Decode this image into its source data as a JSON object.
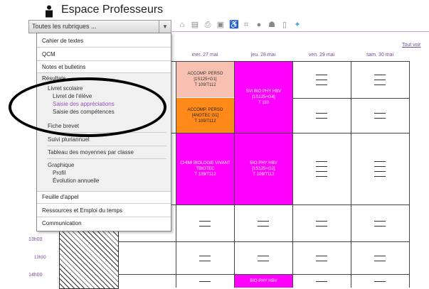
{
  "header": {
    "app_title": "Espace Professeurs"
  },
  "menu_combo": {
    "label": "Toutes les rubriques ..."
  },
  "toolbar": {
    "icons": [
      "home-icon",
      "calendar-icon",
      "print-icon",
      "document-icon",
      "accessibility-icon",
      "crop-icon",
      "help-icon",
      "people-icon",
      "notepad-icon",
      "twitter-icon"
    ]
  },
  "calendar": {
    "tout_voir": "Tout voir",
    "days": [
      "mer. 27 mai",
      "jeu. 28 mai",
      "ven. 29 mai",
      "sam. 30 mai"
    ],
    "times": [
      "13h00",
      "13h30",
      "14h00"
    ],
    "slots": {
      "s1": [
        "ACCOMP. PERSO",
        "[1S125+G1]",
        "T 109/T112"
      ],
      "s2": [
        "ACCOMP. PERSO",
        "[4NOTEC G1]",
        "T 109/T112"
      ],
      "s3": [
        "SVI BIO PHY HBV",
        "[1S125+G4]",
        "T 110"
      ],
      "s4": [
        "CHIMI BIOLOGIE VIVANT",
        "TBIOTEC",
        "T 109/T112"
      ],
      "s5": [
        "BIO PHY HBV",
        "[1S125+G2]",
        "T 109/T112"
      ],
      "s6": [
        "BIO PHY HBV"
      ]
    }
  },
  "menu": {
    "cahier": "Cahier de textes",
    "qcm": "QCM",
    "notes": "Notes et bulletins",
    "resultats": "Résultats",
    "livret_scolaire": "Livret scolaire",
    "livret_eleve": "Livret de l'élève",
    "saisie_appreciations": "Saisie des appréciations",
    "saisie_competences": "Saisie des compétences",
    "fiche_brevet": "Fiche brevet",
    "suivi_pluriannuel": "Suivi pluriannuel",
    "tableau_moyennes": "Tableau des moyennes par classe",
    "graphique": "Graphique",
    "profil": "Profil",
    "evolution": "Évolution annuelle",
    "feuille_appel": "Feuille d'appel",
    "ressources": "Ressources et Emploi du temps",
    "communication": "Communication"
  },
  "colors": {
    "magenta": "#ff00ff",
    "orange": "#ff8a19",
    "pink": "#f7c0b0",
    "accent": "#9b4ec0"
  }
}
